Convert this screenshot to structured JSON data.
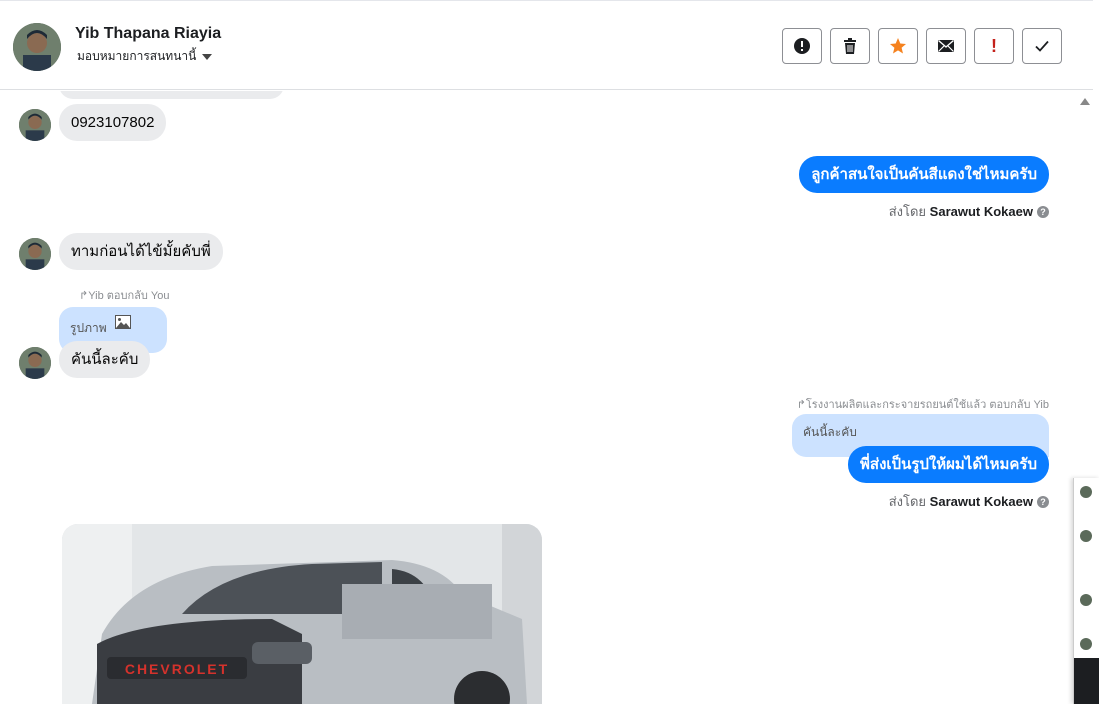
{
  "header": {
    "contact_name": "Yib Thapana Riayia",
    "assignment_label": "มอบหมายการสนทนานี้",
    "actions": [
      {
        "name": "spam-button",
        "icon": "alert-circle-icon"
      },
      {
        "name": "delete-button",
        "icon": "trash-icon"
      },
      {
        "name": "star-button",
        "icon": "star-icon"
      },
      {
        "name": "mark-unread-button",
        "icon": "envelope-icon"
      },
      {
        "name": "priority-button",
        "icon": "exclamation-icon",
        "label": "!"
      },
      {
        "name": "done-button",
        "icon": "check-icon"
      }
    ]
  },
  "messages": {
    "phone": "0923107802",
    "out1": "ลูกค้าสนใจเป็นคันสีแดงใช่ไหมครับ",
    "out1_sent_prefix": "ส่งโดย",
    "out1_sent_name": "Sarawut Kokaew",
    "in2": "ทามก่อนได้ไข้มั้ยคับพี่",
    "reply_note_in": "Yib ตอบกลับ You",
    "quote_in": "รูปภาพ",
    "in3": "คันนี้ละคับ",
    "reply_note_out": "โรงงานผลิตและกระจายรถยนต์ใช้แล้ว ตอบกลับ Yib",
    "quote_out": "คันนี้ละคับ",
    "out2": "พี่ส่งเป็นรูปให้ผมได้ไหมครับ",
    "out2_sent_prefix": "ส่งโดย",
    "out2_sent_name": "Sarawut Kokaew",
    "photo_brand_text": "CHEVROLET"
  },
  "colors": {
    "outgoing_bubble": "#0a7cff",
    "incoming_bubble": "#eaebed",
    "quote_bubble": "#cce2ff",
    "star": "#f5821f",
    "priority": "#c4211b"
  }
}
